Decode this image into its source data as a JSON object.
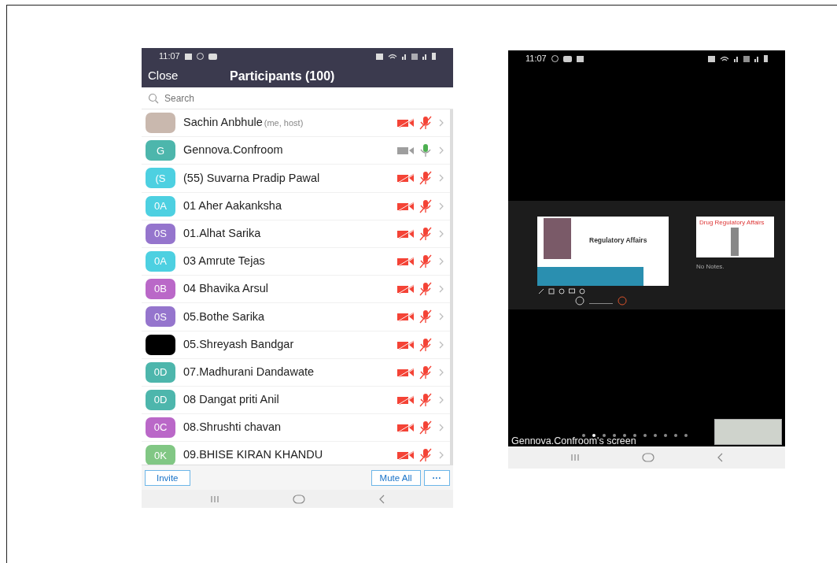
{
  "participants_phone": {
    "status_bar": {
      "time": "11:07"
    },
    "header": {
      "close": "Close",
      "title": "Participants (100)"
    },
    "search": {
      "placeholder": "Search"
    },
    "participants": [
      {
        "name": "Sachin Anbhule",
        "tag": "(me, host)",
        "kind": "photo",
        "video_muted": true,
        "audio_muted": true
      },
      {
        "name": "Gennova.Confroom",
        "initials": "G",
        "kind": "initials",
        "color": "#4db6ac",
        "video_muted": false,
        "audio_muted": false
      },
      {
        "name": "(55) Suvarna Pradip Pawal",
        "initials": "(S",
        "kind": "initials",
        "color": "#4dd0e1",
        "video_muted": true,
        "audio_muted": true
      },
      {
        "name": "01 Aher Aakanksha",
        "initials": "0A",
        "kind": "initials",
        "color": "#4dd0e1",
        "video_muted": true,
        "audio_muted": true
      },
      {
        "name": "01.Alhat Sarika",
        "initials": "0S",
        "kind": "initials",
        "color": "#9575cd",
        "video_muted": true,
        "audio_muted": true
      },
      {
        "name": "03 Amrute Tejas",
        "initials": "0A",
        "kind": "initials",
        "color": "#4dd0e1",
        "video_muted": true,
        "audio_muted": true
      },
      {
        "name": "04 Bhavika Arsul",
        "initials": "0B",
        "kind": "initials",
        "color": "#ba68c8",
        "video_muted": true,
        "audio_muted": true
      },
      {
        "name": "05.Bothe Sarika",
        "initials": "0S",
        "kind": "initials",
        "color": "#9575cd",
        "video_muted": true,
        "audio_muted": true
      },
      {
        "name": "05.Shreyash Bandgar",
        "kind": "blank",
        "video_muted": true,
        "audio_muted": true
      },
      {
        "name": "07.Madhurani Dandawate",
        "initials": "0D",
        "kind": "initials",
        "color": "#4db6ac",
        "video_muted": true,
        "audio_muted": true
      },
      {
        "name": "08 Dangat priti Anil",
        "initials": "0D",
        "kind": "initials",
        "color": "#4db6ac",
        "video_muted": true,
        "audio_muted": true
      },
      {
        "name": "08.Shrushti chavan",
        "initials": "0C",
        "kind": "initials",
        "color": "#ba68c8",
        "video_muted": true,
        "audio_muted": true
      },
      {
        "name": "09.BHISE KIRAN KHANDU",
        "initials": "0K",
        "kind": "initials",
        "color": "#81c784",
        "video_muted": true,
        "audio_muted": true
      }
    ],
    "footer": {
      "invite": "Invite",
      "mute_all": "Mute All",
      "more": "···"
    }
  },
  "screen_share_phone": {
    "status_bar": {
      "time": "11:07"
    },
    "slide_title": "Regulatory Affairs",
    "next_slide_title": "Drug Regulatory Affairs",
    "notes": "No Notes.",
    "pager": [
      {
        "selected": false
      },
      {
        "selected": true
      },
      {
        "selected": false
      },
      {
        "selected": false
      },
      {
        "selected": false
      },
      {
        "selected": false
      },
      {
        "selected": false
      },
      {
        "selected": false
      },
      {
        "selected": false
      },
      {
        "selected": false
      },
      {
        "selected": false
      }
    ],
    "caption": "Gennova.Confroom's screen"
  }
}
